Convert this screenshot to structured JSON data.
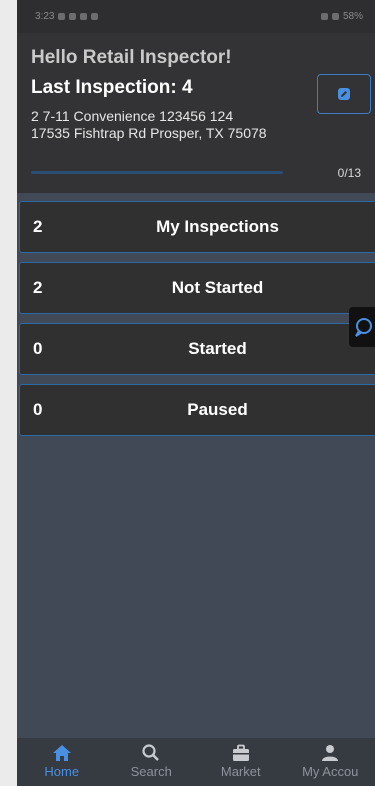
{
  "status_bar": {
    "time": "3:23",
    "battery": "58%"
  },
  "header": {
    "greeting": "Hello Retail Inspector!",
    "last_inspection": "Last Inspection: 4",
    "store_line1": "2 7-11 Convenience 123456 124",
    "store_line2": "17535 Fishtrap Rd Prosper, TX 75078",
    "progress_text": "0/13",
    "progress_value": 0
  },
  "cards": [
    {
      "count": "2",
      "title": "My Inspections"
    },
    {
      "count": "2",
      "title": "Not Started"
    },
    {
      "count": "0",
      "title": "Started"
    },
    {
      "count": "0",
      "title": "Paused"
    }
  ],
  "tabs": [
    {
      "label": "Home",
      "icon": "home-icon"
    },
    {
      "label": "Search",
      "icon": "search-icon"
    },
    {
      "label": "Market",
      "icon": "briefcase-icon"
    },
    {
      "label": "My Accou",
      "icon": "user-icon"
    }
  ],
  "colors": {
    "accent": "#4a90e2",
    "card_border": "#2b6aa6",
    "background": "#414956"
  }
}
